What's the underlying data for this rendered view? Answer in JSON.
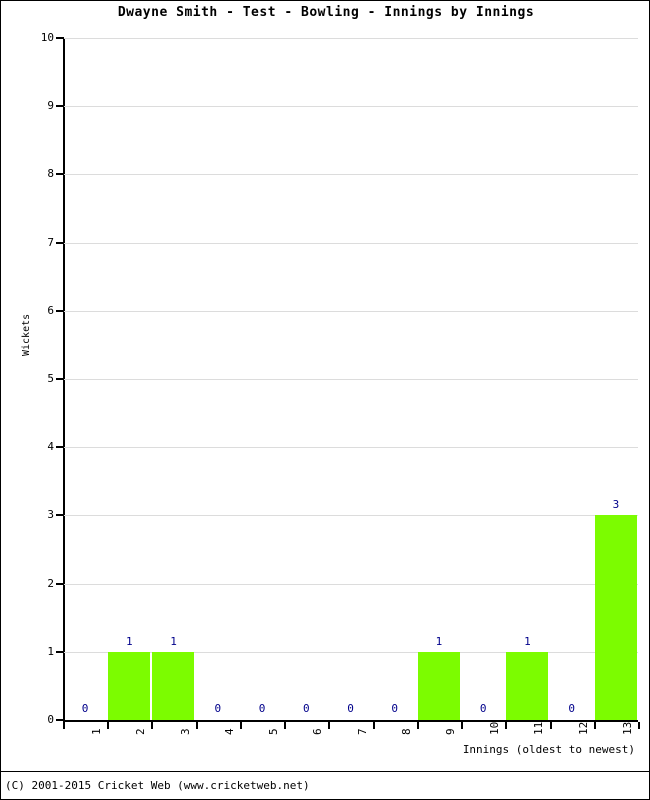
{
  "chart_data": {
    "type": "bar",
    "title": "Dwayne Smith - Test - Bowling - Innings by Innings",
    "xlabel": "Innings (oldest to newest)",
    "ylabel": "Wickets",
    "categories": [
      "1",
      "2",
      "3",
      "4",
      "5",
      "6",
      "7",
      "8",
      "9",
      "10",
      "11",
      "12",
      "13"
    ],
    "values": [
      0,
      1,
      1,
      0,
      0,
      0,
      0,
      0,
      1,
      0,
      1,
      0,
      3
    ],
    "data_labels": [
      "0",
      "1",
      "1",
      "0",
      "0",
      "0",
      "0",
      "0",
      "1",
      "0",
      "1",
      "0",
      "3"
    ],
    "ylim": [
      0,
      10
    ],
    "ytick_labels": [
      "0",
      "1",
      "2",
      "3",
      "4",
      "5",
      "6",
      "7",
      "8",
      "9",
      "10"
    ],
    "ytick_values": [
      0,
      1,
      2,
      3,
      4,
      5,
      6,
      7,
      8,
      9,
      10
    ],
    "grid": true,
    "legend": false,
    "bar_color": "#7cfc00",
    "label_color": "#00008b",
    "axis_color": "#000000",
    "grid_color": "#dcdcdc",
    "background": "#ffffff"
  },
  "footer": {
    "copyright": "(C) 2001-2015 Cricket Web (www.cricketweb.net)"
  }
}
